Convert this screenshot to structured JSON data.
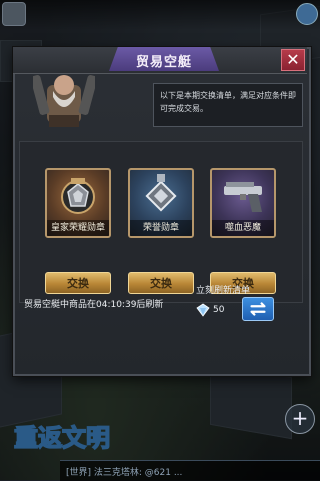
{
  "dialog": {
    "title": "贸易空艇",
    "close_symbol": "✕",
    "speech": "以下是本期交换清单，满足对应条件即可完成交易。"
  },
  "items": [
    {
      "label": "皇家荣耀勋章",
      "icon": "royal-honor-medal-icon",
      "frame_color": "#9d6b3e"
    },
    {
      "label": "荣誉勋章",
      "icon": "honor-medal-icon",
      "frame_color": "#4a6d90"
    },
    {
      "label": "噬血恶魔",
      "icon": "pistol-icon",
      "frame_color": "#6a5a8f"
    }
  ],
  "buttons": {
    "exchange_1": "交换",
    "exchange_2": "交换",
    "exchange_3": "交换"
  },
  "refresh": {
    "info": "贸易空艇中商品在04:10:39后刷新",
    "now_label": "立刻刷新清单",
    "cost": "50",
    "cost_icon": "diamond-icon",
    "button_icon": "refresh-icon"
  },
  "hud": {
    "logo_text": "重返文明",
    "chat_text": "[世界] 法三克塔林: @621 ...",
    "plus_symbol": "+"
  }
}
